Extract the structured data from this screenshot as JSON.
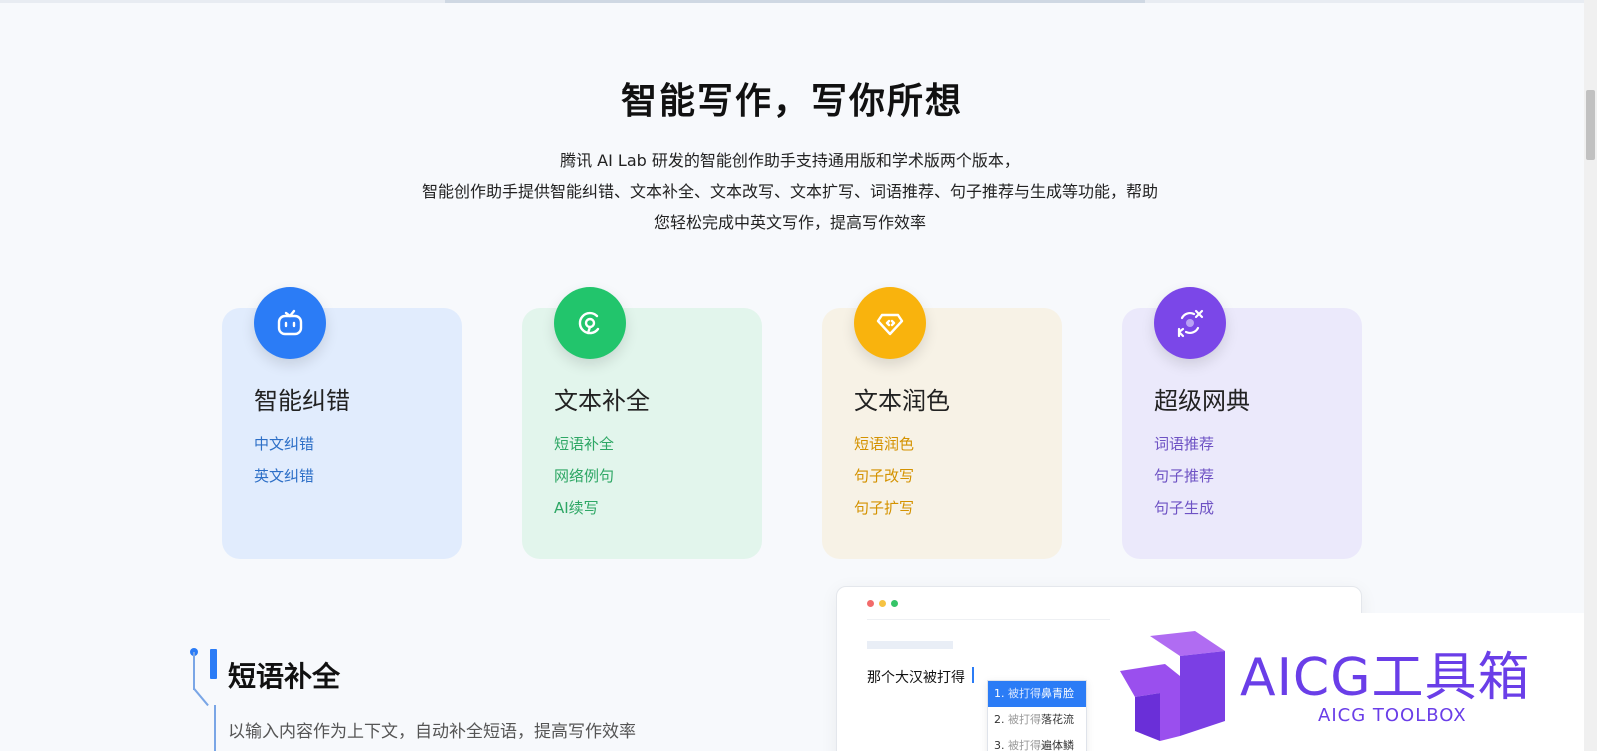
{
  "hero": {
    "title": "智能写作，写你所想",
    "desc_line1": "腾讯 AI Lab 研发的智能创作助手支持通用版和学术版两个版本，",
    "desc_line2": "智能创作助手提供智能纠错、文本补全、文本改写、文本扩写、词语推荐、句子推荐与生成等功能，帮助",
    "desc_line3": "您轻松完成中英文写作，提高写作效率"
  },
  "features": [
    {
      "title": "智能纠错",
      "icon": "robot-face-icon",
      "color": "#2b7cf6",
      "links": [
        "中文纠错",
        "英文纠错"
      ]
    },
    {
      "title": "文本补全",
      "icon": "refresh-cycle-icon",
      "color": "#22c56c",
      "links": [
        "短语补全",
        "网络例句",
        "AI续写"
      ]
    },
    {
      "title": "文本润色",
      "icon": "gem-code-icon",
      "color": "#f9b30d",
      "links": [
        "短语润色",
        "句子改写",
        "句子扩写"
      ]
    },
    {
      "title": "超级网典",
      "icon": "translate-arrows-icon",
      "color": "#7b47e8",
      "links": [
        "词语推荐",
        "句子推荐",
        "句子生成"
      ]
    }
  ],
  "section": {
    "title": "短语补全",
    "desc": "以输入内容作为上下文，自动补全短语，提高写作效率"
  },
  "demo": {
    "input_text": "那个大汉被打得",
    "suggestions": [
      {
        "num": "1.",
        "prefix": "被打得",
        "text": "鼻青脸"
      },
      {
        "num": "2.",
        "prefix": "被打得",
        "text": "落花流"
      },
      {
        "num": "3.",
        "prefix": "被打得",
        "text": "遍体鳞"
      }
    ]
  },
  "watermark": {
    "brand": "AICG工具箱",
    "sub": "AICG TOOLBOX"
  }
}
